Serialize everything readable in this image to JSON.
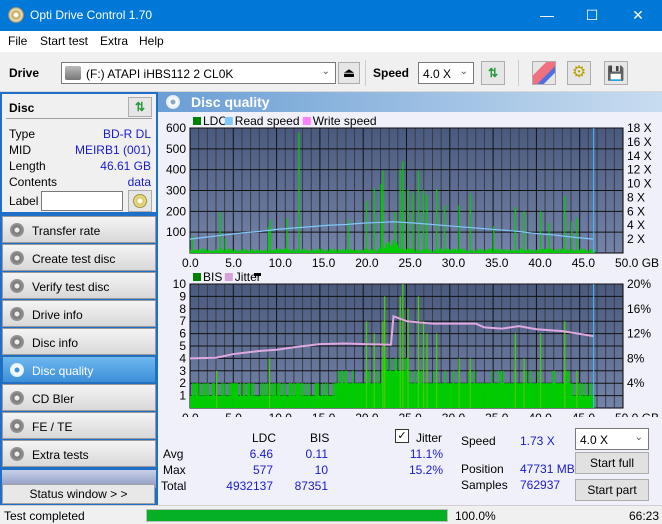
{
  "window": {
    "title": "Opti Drive Control 1.70",
    "controls": {
      "minimize": "—",
      "maximize": "☐",
      "close": "✕"
    }
  },
  "menu": [
    "File",
    "Start test",
    "Extra",
    "Help"
  ],
  "toolbar": {
    "drive_label": "Drive",
    "drive_value": "(F:)  ATAPI iHBS112  2 CL0K",
    "speed_label": "Speed",
    "speed_value": "4.0 X",
    "icons": [
      "drive-icon",
      "eject-icon",
      "refresh-icon",
      "erase-icon",
      "settings-icon",
      "save-icon"
    ]
  },
  "disc": {
    "header": "Disc",
    "fields": [
      {
        "key": "Type",
        "value": "BD-R DL"
      },
      {
        "key": "MID",
        "value": "MEIRB1 (001)"
      },
      {
        "key": "Length",
        "value": "46.61 GB"
      },
      {
        "key": "Contents",
        "value": "data"
      }
    ],
    "label_key": "Label",
    "label_value": ""
  },
  "nav": [
    {
      "label": "Transfer rate",
      "active": false
    },
    {
      "label": "Create test disc",
      "active": false
    },
    {
      "label": "Verify test disc",
      "active": false
    },
    {
      "label": "Drive info",
      "active": false
    },
    {
      "label": "Disc info",
      "active": false
    },
    {
      "label": "Disc quality",
      "active": true
    },
    {
      "label": "CD Bler",
      "active": false
    },
    {
      "label": "FE / TE",
      "active": false
    },
    {
      "label": "Extra tests",
      "active": false
    }
  ],
  "status_window_label": "Status window > >",
  "panel_title": "Disc quality",
  "chart_data": [
    {
      "type": "bar",
      "title": "LDC / Read speed",
      "legend": [
        {
          "name": "LDC",
          "color": "#008000"
        },
        {
          "name": "Read speed",
          "color": "#80c8f8"
        },
        {
          "name": "Write speed",
          "color": "#ff80ff"
        }
      ],
      "legend_position": "top-left",
      "xlabel": "GB",
      "xlim": [
        0,
        50
      ],
      "x_ticks": [
        "0.0",
        "5.0",
        "10.0",
        "15.0",
        "20.0",
        "25.0",
        "30.0",
        "35.0",
        "40.0",
        "45.0",
        "50.0 GB"
      ],
      "ylim": [
        0,
        600
      ],
      "y_ticks": [
        "100",
        "200",
        "300",
        "400",
        "500",
        "600"
      ],
      "y2lim": [
        0,
        18
      ],
      "y2_ticks": [
        "2 X",
        "4 X",
        "6 X",
        "8 X",
        "10 X",
        "12 X",
        "14 X",
        "16 X",
        "18 X"
      ],
      "grid": true,
      "end_marker_gb": 46.61,
      "ldc_spikes": [
        {
          "x": 0.2,
          "y": 80
        },
        {
          "x": 3.4,
          "y": 195
        },
        {
          "x": 4.0,
          "y": 70
        },
        {
          "x": 9.0,
          "y": 125
        },
        {
          "x": 9.2,
          "y": 160
        },
        {
          "x": 11.1,
          "y": 165
        },
        {
          "x": 12.5,
          "y": 577
        },
        {
          "x": 18.2,
          "y": 160
        },
        {
          "x": 20.3,
          "y": 250
        },
        {
          "x": 21.2,
          "y": 310
        },
        {
          "x": 22.0,
          "y": 330
        },
        {
          "x": 22.2,
          "y": 395
        },
        {
          "x": 23.6,
          "y": 195
        },
        {
          "x": 24.2,
          "y": 400
        },
        {
          "x": 24.5,
          "y": 440
        },
        {
          "x": 25.1,
          "y": 305
        },
        {
          "x": 25.7,
          "y": 290
        },
        {
          "x": 26.3,
          "y": 395
        },
        {
          "x": 26.9,
          "y": 300
        },
        {
          "x": 27.3,
          "y": 280
        },
        {
          "x": 28.4,
          "y": 305
        },
        {
          "x": 29.3,
          "y": 230
        },
        {
          "x": 31.0,
          "y": 230
        },
        {
          "x": 32.3,
          "y": 285
        },
        {
          "x": 35.0,
          "y": 130
        },
        {
          "x": 37.5,
          "y": 220
        },
        {
          "x": 38.5,
          "y": 200
        },
        {
          "x": 40.4,
          "y": 200
        },
        {
          "x": 41.4,
          "y": 145
        },
        {
          "x": 43.2,
          "y": 275
        },
        {
          "x": 44.0,
          "y": 150
        },
        {
          "x": 44.6,
          "y": 170
        }
      ],
      "read_speed": [
        {
          "x": 0,
          "y": 2.0
        },
        {
          "x": 2,
          "y": 2.3
        },
        {
          "x": 4,
          "y": 2.6
        },
        {
          "x": 6,
          "y": 2.9
        },
        {
          "x": 8,
          "y": 3.1
        },
        {
          "x": 10,
          "y": 3.4
        },
        {
          "x": 12,
          "y": 3.6
        },
        {
          "x": 14,
          "y": 3.8
        },
        {
          "x": 16,
          "y": 4.0
        },
        {
          "x": 18,
          "y": 4.1
        },
        {
          "x": 20,
          "y": 4.3
        },
        {
          "x": 22,
          "y": 4.4
        },
        {
          "x": 23.5,
          "y": 4.5
        },
        {
          "x": 26,
          "y": 4.3
        },
        {
          "x": 28,
          "y": 4.1
        },
        {
          "x": 30,
          "y": 3.9
        },
        {
          "x": 32,
          "y": 3.7
        },
        {
          "x": 34,
          "y": 3.5
        },
        {
          "x": 36,
          "y": 3.3
        },
        {
          "x": 38,
          "y": 3.1
        },
        {
          "x": 40,
          "y": 2.8
        },
        {
          "x": 42,
          "y": 2.6
        },
        {
          "x": 44,
          "y": 2.3
        },
        {
          "x": 46.6,
          "y": 2.0
        }
      ]
    },
    {
      "type": "bar",
      "title": "BIS / Jitter",
      "legend": [
        {
          "name": "BIS",
          "color": "#008000"
        },
        {
          "name": "Jitter",
          "color": "#d8a0d8"
        }
      ],
      "legend_position": "top-left",
      "xlabel": "GB",
      "xlim": [
        0,
        50
      ],
      "x_ticks": [
        "0.0",
        "5.0",
        "10.0",
        "15.0",
        "20.0",
        "25.0",
        "30.0",
        "35.0",
        "40.0",
        "45.0",
        "50.0 GB"
      ],
      "ylim": [
        0,
        10
      ],
      "y_ticks": [
        "1",
        "2",
        "3",
        "4",
        "5",
        "6",
        "7",
        "8",
        "9",
        "10"
      ],
      "y2lim": [
        0,
        20
      ],
      "y2_ticks": [
        "4%",
        "8%",
        "12%",
        "16%",
        "20%"
      ],
      "grid": true,
      "end_marker_gb": 46.61,
      "bis_spikes": [
        {
          "x": 3.0,
          "y": 3
        },
        {
          "x": 9.1,
          "y": 4
        },
        {
          "x": 20.3,
          "y": 7
        },
        {
          "x": 21.2,
          "y": 6
        },
        {
          "x": 22.2,
          "y": 7
        },
        {
          "x": 22.4,
          "y": 9
        },
        {
          "x": 24.2,
          "y": 9
        },
        {
          "x": 24.5,
          "y": 10
        },
        {
          "x": 25.1,
          "y": 8
        },
        {
          "x": 26.3,
          "y": 9
        },
        {
          "x": 26.9,
          "y": 7
        },
        {
          "x": 27.3,
          "y": 6
        },
        {
          "x": 28.4,
          "y": 6
        },
        {
          "x": 31.0,
          "y": 4
        },
        {
          "x": 32.3,
          "y": 4
        },
        {
          "x": 37.5,
          "y": 6
        },
        {
          "x": 38.5,
          "y": 4
        },
        {
          "x": 40.4,
          "y": 6
        },
        {
          "x": 43.2,
          "y": 7
        },
        {
          "x": 44.6,
          "y": 3
        }
      ],
      "jitter": [
        {
          "x": 0,
          "y": 8.0
        },
        {
          "x": 3,
          "y": 8.1
        },
        {
          "x": 5,
          "y": 8.7
        },
        {
          "x": 8,
          "y": 9.2
        },
        {
          "x": 10,
          "y": 9.4
        },
        {
          "x": 12,
          "y": 9.8
        },
        {
          "x": 15,
          "y": 10.3
        },
        {
          "x": 18,
          "y": 10.4
        },
        {
          "x": 20,
          "y": 10.3
        },
        {
          "x": 23.2,
          "y": 10.2
        },
        {
          "x": 23.5,
          "y": 14.8
        },
        {
          "x": 25,
          "y": 14.0
        },
        {
          "x": 28,
          "y": 13.6
        },
        {
          "x": 31,
          "y": 13.6
        },
        {
          "x": 33,
          "y": 13.6
        },
        {
          "x": 34,
          "y": 13.0
        },
        {
          "x": 36,
          "y": 12.8
        },
        {
          "x": 38,
          "y": 13.2
        },
        {
          "x": 40,
          "y": 12.7
        },
        {
          "x": 43,
          "y": 12.4
        },
        {
          "x": 46.6,
          "y": 11.6
        }
      ]
    }
  ],
  "stats": {
    "col_ldc": "LDC",
    "col_bis": "BIS",
    "jitter_label": "Jitter",
    "jitter_checked": true,
    "rows": [
      {
        "label": "Avg",
        "ldc": "6.46",
        "bis": "0.11",
        "jitter": "11.1%"
      },
      {
        "label": "Max",
        "ldc": "577",
        "bis": "10",
        "jitter": "15.2%"
      },
      {
        "label": "Total",
        "ldc": "4932137",
        "bis": "87351",
        "jitter": ""
      }
    ],
    "speed_label": "Speed",
    "speed_value": "1.73 X",
    "position_label": "Position",
    "position_value": "47731 MB",
    "samples_label": "Samples",
    "samples_value": "762937",
    "speed_select": "4.0 X",
    "start_full": "Start full",
    "start_part": "Start part"
  },
  "statusbar": {
    "text": "Test completed",
    "progress": 100.0,
    "progress_text": "100.0%",
    "time": "66:23"
  }
}
